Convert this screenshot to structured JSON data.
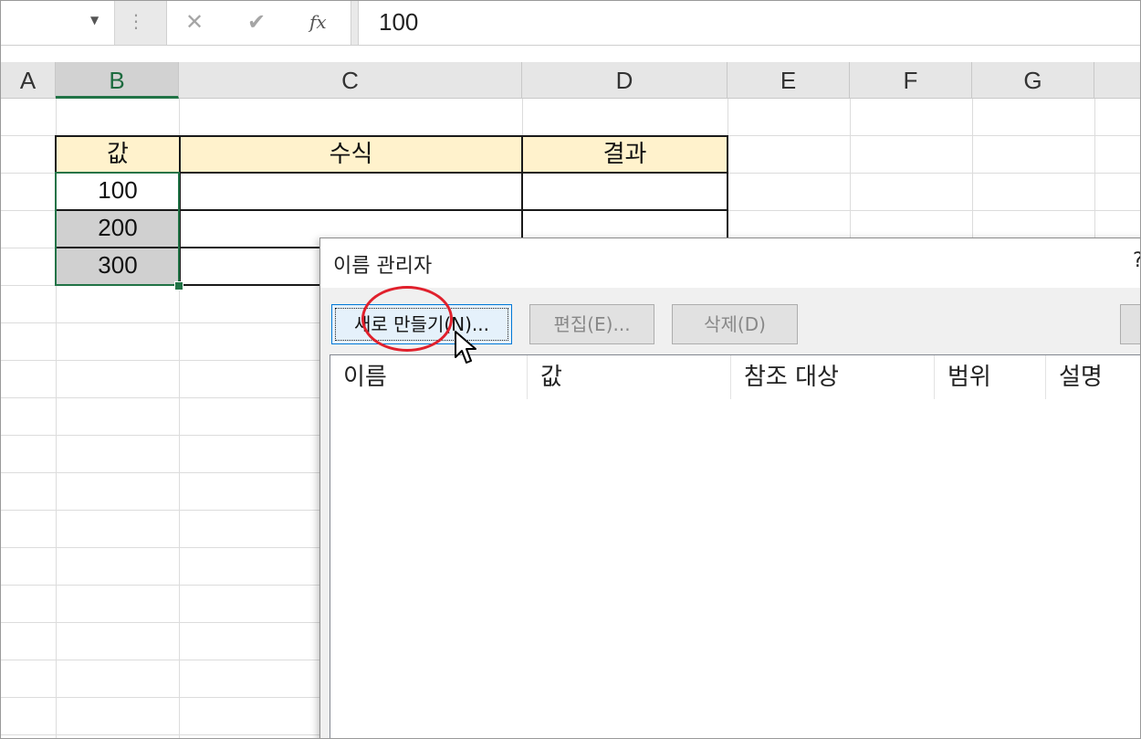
{
  "formula_bar": {
    "name_box_value": "",
    "cancel_icon": "✕",
    "enter_icon": "✔",
    "fx_label": "fx",
    "formula_value": "100"
  },
  "columns": [
    "A",
    "B",
    "C",
    "D",
    "E",
    "F",
    "G"
  ],
  "table": {
    "headers": [
      "값",
      "수식",
      "결과"
    ],
    "rows": [
      {
        "value": "100",
        "formula": "",
        "result": ""
      },
      {
        "value": "200",
        "formula": "",
        "result": ""
      },
      {
        "value": "300",
        "formula": "",
        "result": ""
      }
    ]
  },
  "dialog": {
    "title": "이름 관리자",
    "help": "?",
    "buttons": {
      "new": "새로 만들기(N)...",
      "edit": "편집(E)...",
      "delete": "삭제(D)"
    },
    "list_headers": [
      "이름",
      "값",
      "참조 대상",
      "범위",
      "설명"
    ]
  },
  "colors": {
    "selection": "#217346",
    "header_fill": "#fff2cc",
    "highlight_circle": "#e0202c"
  }
}
